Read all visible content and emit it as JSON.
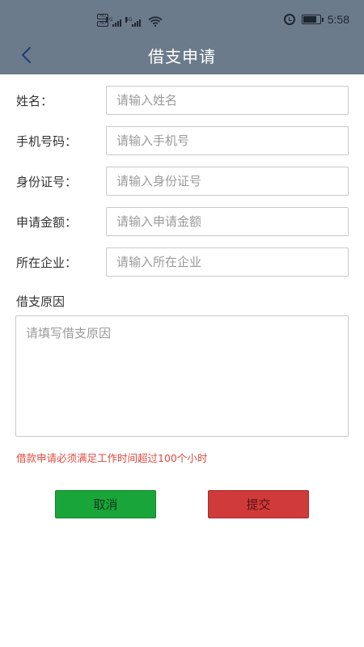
{
  "status_bar": {
    "time": "5:58",
    "signal1_tag": "4G",
    "signal2_tag": "4G",
    "icons": [
      "hd-icon",
      "signal-icon",
      "signal-icon",
      "wifi-icon",
      "alarm-icon",
      "battery-icon"
    ],
    "battery_level": 0.8
  },
  "header": {
    "title": "借支申请",
    "back_icon": "chevron-left-icon",
    "bg_color": "#6c7b8b"
  },
  "form": {
    "name_label": "姓名：",
    "name_placeholder": "请输入姓名",
    "phone_label": "手机号码：",
    "phone_placeholder": "请输入手机号",
    "id_label": "身份证号：",
    "id_placeholder": "请输入身份证号",
    "amount_label": "申请金额：",
    "amount_placeholder": "请输入申请金额",
    "company_label": "所在企业：",
    "company_placeholder": "请输入所在企业",
    "reason_label": "借支原因",
    "reason_placeholder": "请填写借支原因"
  },
  "notice": "借款申请必须满足工作时间超过100个小时",
  "buttons": {
    "cancel_label": "取消",
    "submit_label": "提交",
    "cancel_color": "#1aa53a",
    "submit_color": "#d03a3a"
  },
  "colors": {
    "notice": "#e0483e"
  }
}
